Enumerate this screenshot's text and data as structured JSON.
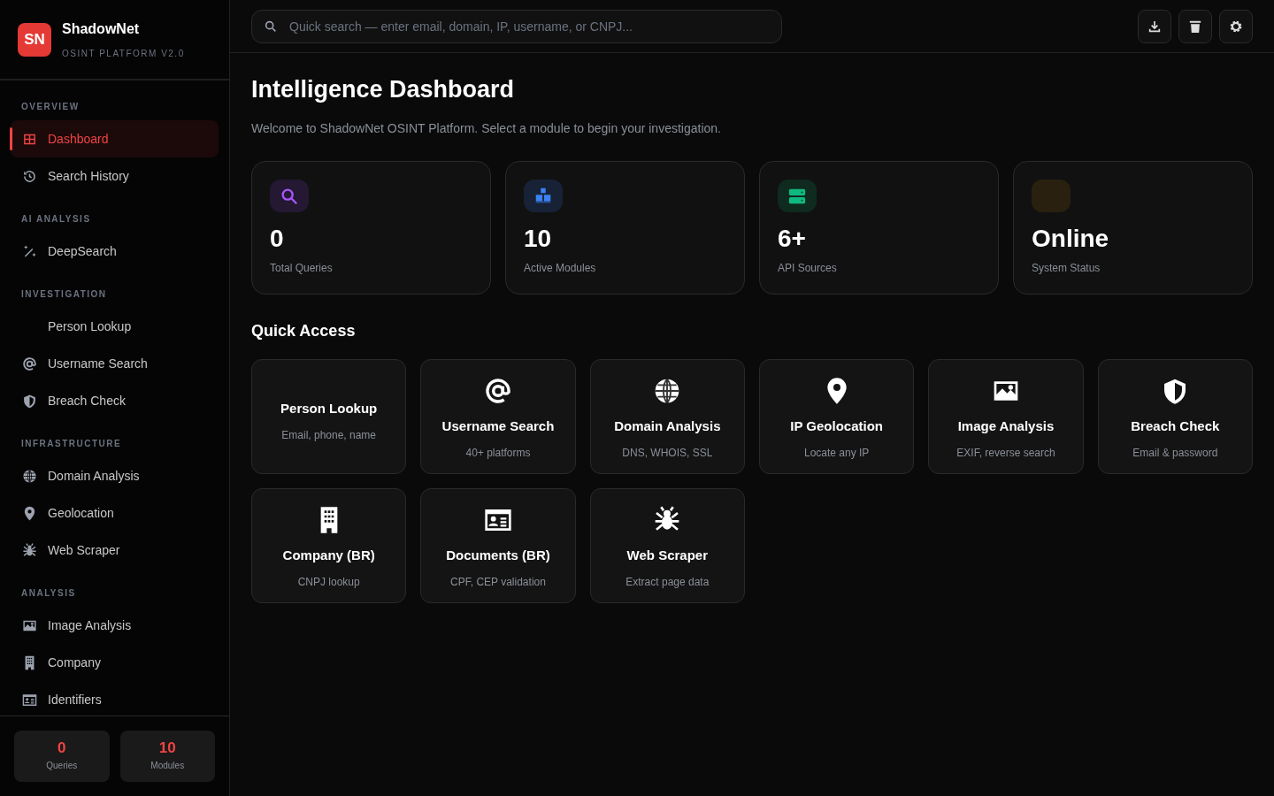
{
  "brand": {
    "logo": "SN",
    "name": "ShadowNet",
    "tagline": "OSINT PLATFORM V2.0"
  },
  "sidebar": {
    "sections": [
      {
        "title": "OVERVIEW",
        "items": [
          {
            "label": "Dashboard",
            "selected": true
          },
          {
            "label": "Search History",
            "selected": false
          }
        ]
      },
      {
        "title": "AI ANALYSIS",
        "items": [
          {
            "label": "DeepSearch",
            "selected": false
          }
        ]
      },
      {
        "title": "INVESTIGATION",
        "items": [
          {
            "label": "Person Lookup",
            "selected": false
          },
          {
            "label": "Username Search",
            "selected": false
          },
          {
            "label": "Breach Check",
            "selected": false
          }
        ]
      },
      {
        "title": "INFRASTRUCTURE",
        "items": [
          {
            "label": "Domain Analysis",
            "selected": false
          },
          {
            "label": "Geolocation",
            "selected": false
          },
          {
            "label": "Web Scraper",
            "selected": false
          }
        ]
      },
      {
        "title": "ANALYSIS",
        "items": [
          {
            "label": "Image Analysis",
            "selected": false
          },
          {
            "label": "Company",
            "selected": false
          },
          {
            "label": "Identifiers",
            "selected": false
          }
        ]
      }
    ],
    "stats": [
      {
        "value": "0",
        "label": "Queries"
      },
      {
        "value": "10",
        "label": "Modules"
      }
    ]
  },
  "search": {
    "placeholder": "Quick search — enter email, domain, IP, username, or CNPJ..."
  },
  "page": {
    "title": "Intelligence Dashboard",
    "subtitle": "Welcome to ShadowNet OSINT Platform. Select a module to begin your investigation."
  },
  "stats": [
    {
      "value": "0",
      "label": "Total Queries",
      "color": "#241833"
    },
    {
      "value": "10",
      "label": "Active Modules",
      "color": "#172236"
    },
    {
      "value": "6+",
      "label": "API Sources",
      "color": "#0f2a1f"
    },
    {
      "value": "Online",
      "label": "System Status",
      "color": "#2a2010"
    }
  ],
  "quick_access": {
    "title": "Quick Access",
    "modules": [
      {
        "title": "Person Lookup",
        "subtitle": "Email, phone, name"
      },
      {
        "title": "Username Search",
        "subtitle": "40+ platforms"
      },
      {
        "title": "Domain Analysis",
        "subtitle": "DNS, WHOIS, SSL"
      },
      {
        "title": "IP Geolocation",
        "subtitle": "Locate any IP"
      },
      {
        "title": "Image Analysis",
        "subtitle": "EXIF, reverse search"
      },
      {
        "title": "Breach Check",
        "subtitle": "Email & password"
      },
      {
        "title": "Company (BR)",
        "subtitle": "CNPJ lookup"
      },
      {
        "title": "Documents (BR)",
        "subtitle": "CPF, CEP validation"
      },
      {
        "title": "Web Scraper",
        "subtitle": "Extract page data"
      }
    ]
  }
}
